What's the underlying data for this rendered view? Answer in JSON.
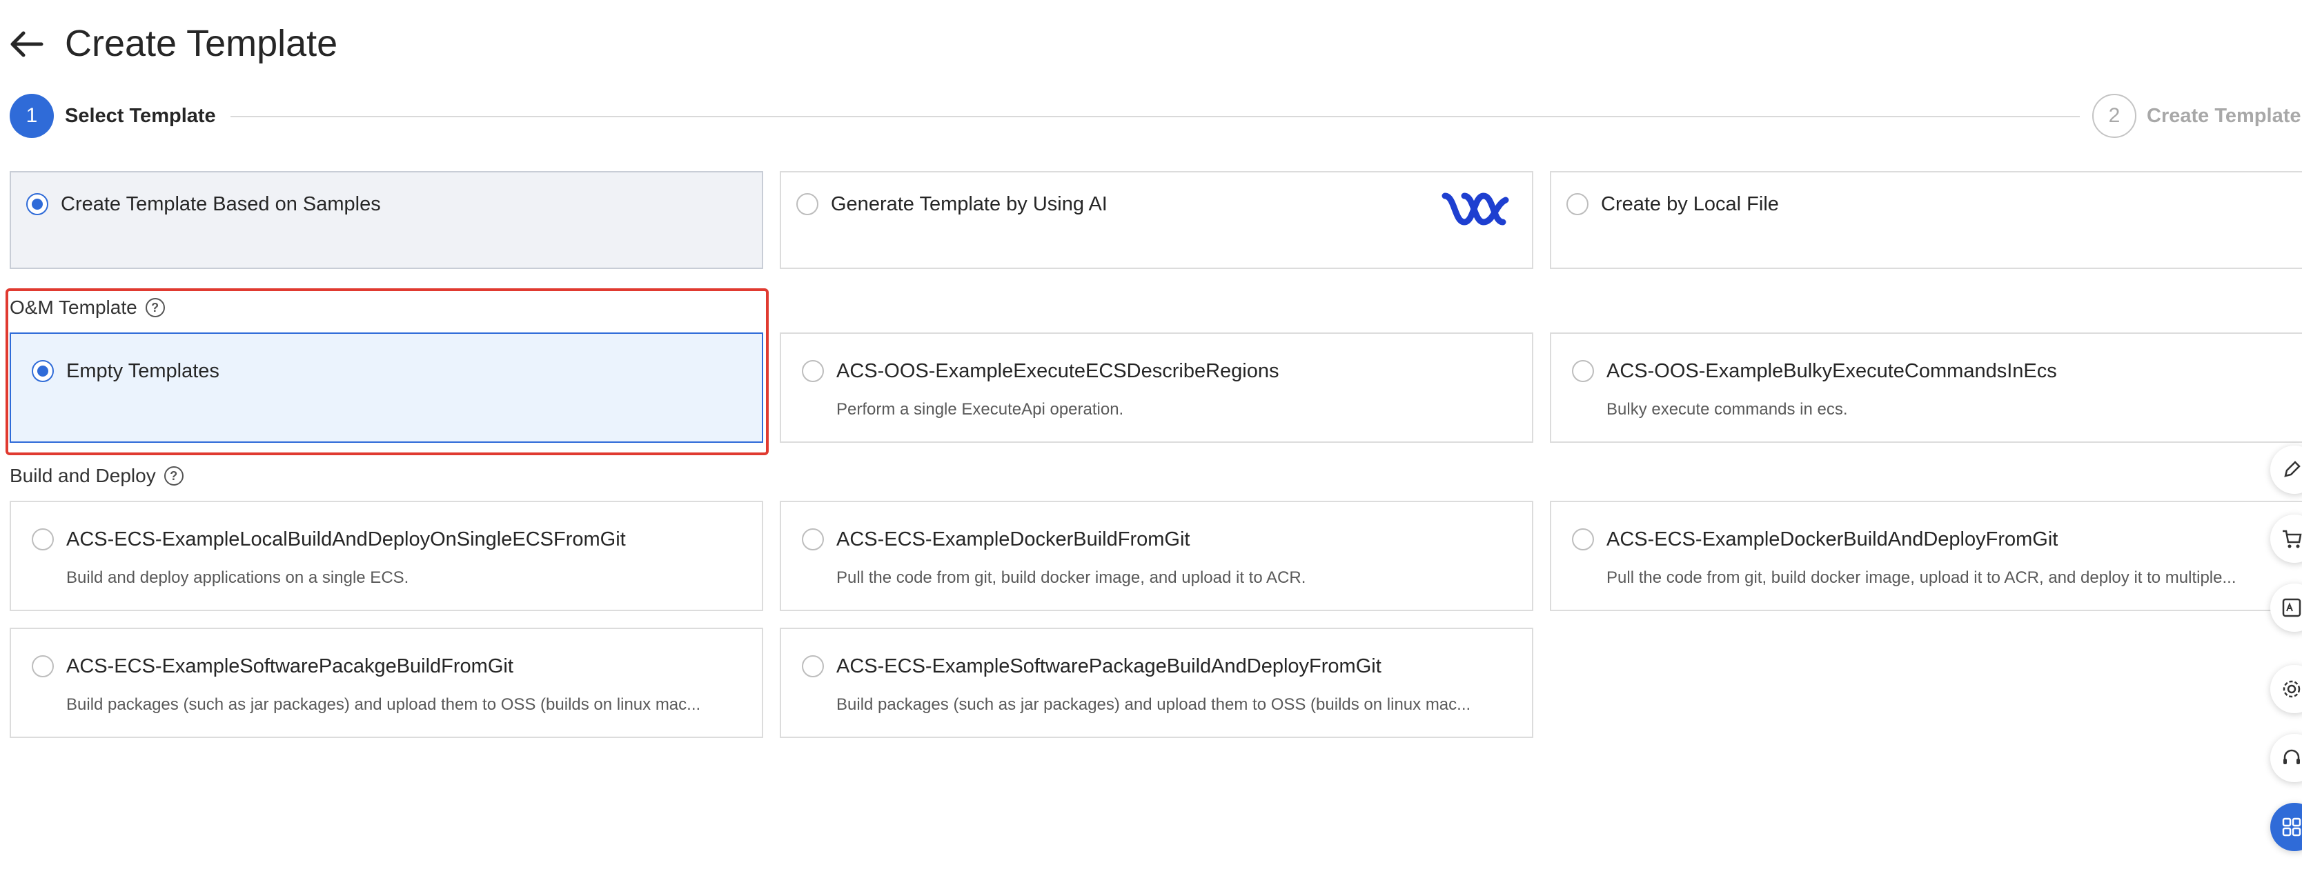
{
  "header": {
    "title": "Create Template"
  },
  "steps": [
    {
      "number": "1",
      "label": "Select Template"
    },
    {
      "number": "2",
      "label": "Create Template"
    }
  ],
  "creation_methods": [
    {
      "label": "Create Template Based on Samples",
      "checked": true
    },
    {
      "label": "Generate Template by Using AI",
      "checked": false
    },
    {
      "label": "Create by Local File",
      "checked": false
    }
  ],
  "sections": {
    "om": {
      "label": "O&M Template",
      "cards": [
        {
          "title": "Empty Templates",
          "desc": ""
        },
        {
          "title": "ACS-OOS-ExampleExecuteECSDescribeRegions",
          "desc": "Perform a single ExecuteApi operation."
        },
        {
          "title": "ACS-OOS-ExampleBulkyExecuteCommandsInEcs",
          "desc": "Bulky execute commands in ecs."
        }
      ]
    },
    "build": {
      "label": "Build and Deploy",
      "cards": [
        {
          "title": "ACS-ECS-ExampleLocalBuildAndDeployOnSingleECSFromGit",
          "desc": "Build and deploy applications on a single ECS."
        },
        {
          "title": "ACS-ECS-ExampleDockerBuildFromGit",
          "desc": "Pull the code from git, build docker image, and upload it to ACR."
        },
        {
          "title": "ACS-ECS-ExampleDockerBuildAndDeployFromGit",
          "desc": "Pull the code from git, build docker image, upload it to ACR, and deploy it to multiple..."
        },
        {
          "title": "ACS-ECS-ExampleSoftwarePacakgeBuildFromGit",
          "desc": "Build packages (such as jar packages) and upload them to OSS (builds on linux mac..."
        },
        {
          "title": "ACS-ECS-ExampleSoftwarePackageBuildAndDeployFromGit",
          "desc": "Build packages (such as jar packages) and upload them to OSS (builds on linux mac..."
        }
      ]
    }
  },
  "icons": {
    "back": "arrow-left-icon",
    "ai_logo": "ai-wave-logo-icon",
    "help": "question-circle-icon",
    "floating": [
      "edit-icon",
      "cart-icon",
      "api-icon",
      "settings-icon",
      "support-icon",
      "apps-grid-icon"
    ]
  },
  "colors": {
    "accent": "#2f6bd8",
    "highlight": "#e03a30",
    "selected_bg": "#ebf3fd"
  }
}
